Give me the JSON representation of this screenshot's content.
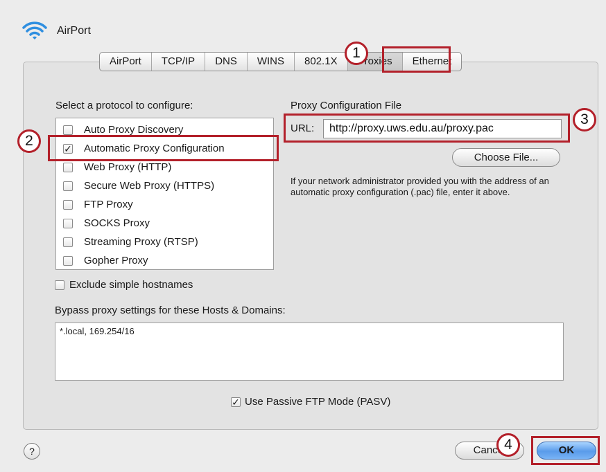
{
  "window": {
    "title": "AirPort",
    "icon": "wifi-icon"
  },
  "tabs": [
    {
      "label": "AirPort"
    },
    {
      "label": "TCP/IP"
    },
    {
      "label": "DNS"
    },
    {
      "label": "WINS"
    },
    {
      "label": "802.1X"
    },
    {
      "label": "Proxies",
      "selected": true
    },
    {
      "label": "Ethernet"
    }
  ],
  "protocols": {
    "heading": "Select a protocol to configure:",
    "items": [
      {
        "label": "Auto Proxy Discovery",
        "checked": false
      },
      {
        "label": "Automatic Proxy Configuration",
        "checked": true
      },
      {
        "label": "Web Proxy (HTTP)",
        "checked": false
      },
      {
        "label": "Secure Web Proxy (HTTPS)",
        "checked": false
      },
      {
        "label": "FTP Proxy",
        "checked": false
      },
      {
        "label": "SOCKS Proxy",
        "checked": false
      },
      {
        "label": "Streaming Proxy (RTSP)",
        "checked": false
      },
      {
        "label": "Gopher Proxy",
        "checked": false
      }
    ]
  },
  "config_file": {
    "heading": "Proxy Configuration File",
    "url_label": "URL:",
    "url_value": "http://proxy.uws.edu.au/proxy.pac",
    "choose_button": "Choose File...",
    "help_text": "If your network administrator provided you with the address of an automatic proxy configuration (.pac) file, enter it above."
  },
  "exclude_simple": {
    "label": "Exclude simple hostnames",
    "checked": false
  },
  "bypass": {
    "label": "Bypass proxy settings for these Hosts & Domains:",
    "value": "*.local, 169.254/16"
  },
  "passive_ftp": {
    "label": "Use Passive FTP Mode (PASV)",
    "checked": true
  },
  "footer": {
    "help": "?",
    "cancel": "Cancel",
    "ok": "OK"
  },
  "callouts": [
    "1",
    "2",
    "3",
    "4"
  ],
  "colors": {
    "annotation": "#b3202a",
    "default_button": "#5a9bea"
  }
}
